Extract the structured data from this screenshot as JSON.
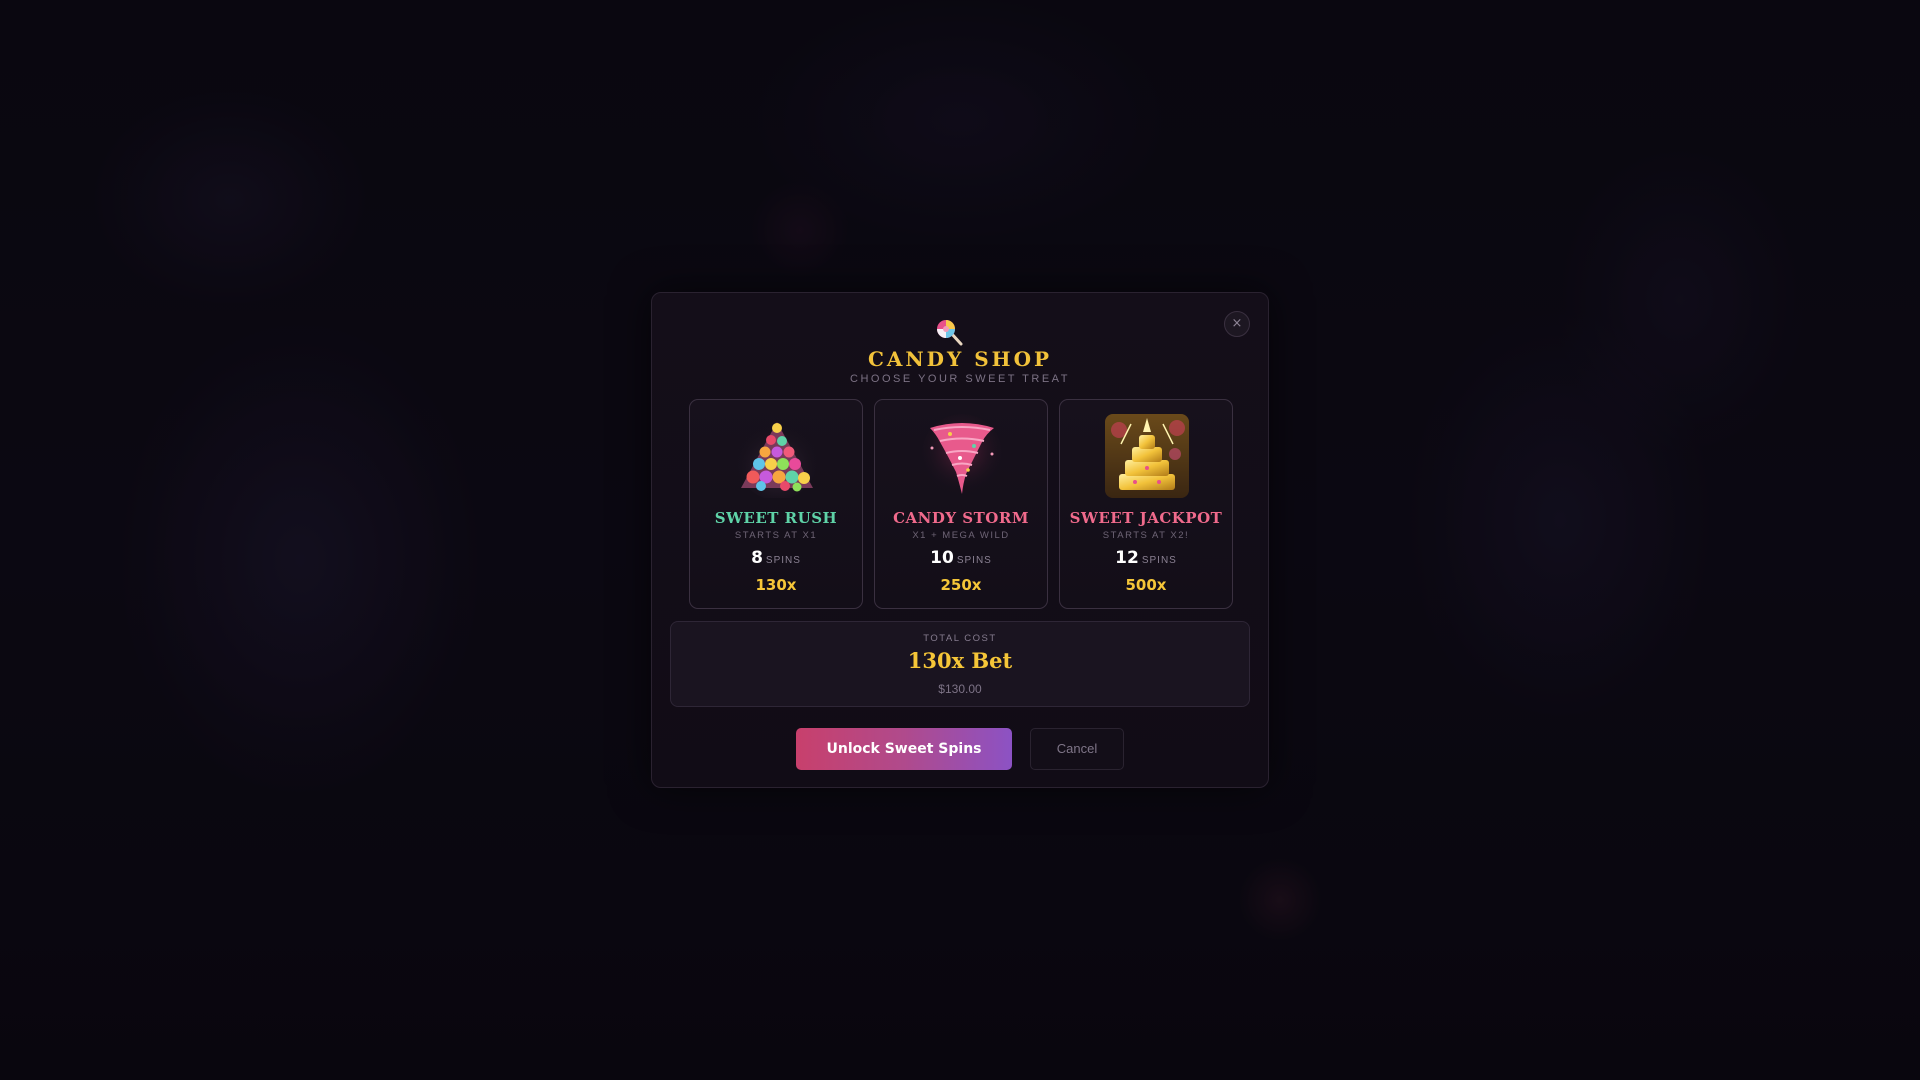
{
  "modal": {
    "title": "CANDY SHOP",
    "subtitle": "CHOOSE YOUR SWEET TREAT",
    "close_label": "×",
    "header_icon": "lollipop-icon"
  },
  "packages": [
    {
      "name": "SWEET RUSH",
      "description": "STARTS AT X1",
      "spins": "8",
      "spins_label": "SPINS",
      "multiplier": "130x",
      "name_color": "#5fd3a8",
      "icon": "candy-pile-icon",
      "selected": true
    },
    {
      "name": "CANDY STORM",
      "description": "X1 + MEGA WILD",
      "spins": "10",
      "spins_label": "SPINS",
      "multiplier": "250x",
      "name_color": "#f06a8c",
      "icon": "candy-tornado-icon",
      "selected": false
    },
    {
      "name": "SWEET JACKPOT",
      "description": "STARTS AT X2!",
      "spins": "12",
      "spins_label": "SPINS",
      "multiplier": "500x",
      "name_color": "#f06a8c",
      "icon": "golden-cake-icon",
      "selected": false
    }
  ],
  "total": {
    "label": "TOTAL COST",
    "value": "130x Bet",
    "amount": "$130.00"
  },
  "actions": {
    "unlock_label": "Unlock Sweet Spins",
    "cancel_label": "Cancel"
  },
  "colors": {
    "gold": "#f5c638",
    "accent_pink": "#c8406c",
    "accent_purple": "#8c52c4"
  }
}
